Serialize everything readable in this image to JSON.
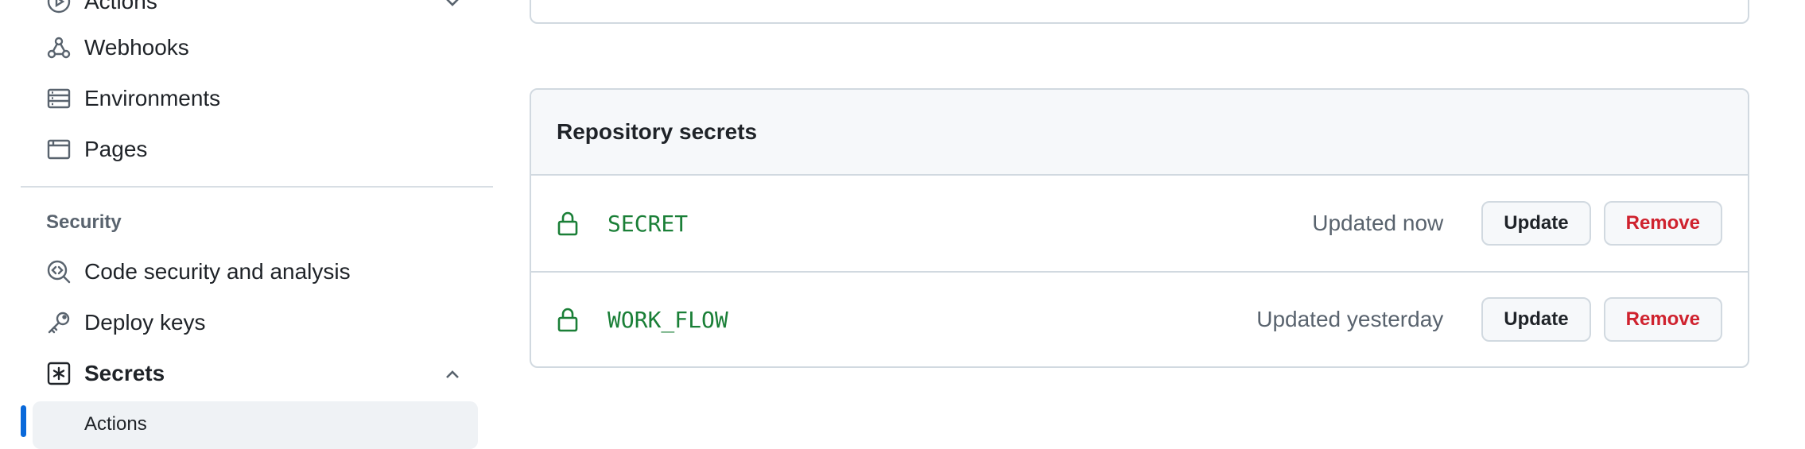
{
  "sidebar": {
    "items": [
      {
        "label": "Actions",
        "icon": "play-circle-icon"
      },
      {
        "label": "Webhooks",
        "icon": "webhook-icon"
      },
      {
        "label": "Environments",
        "icon": "server-icon"
      },
      {
        "label": "Pages",
        "icon": "browser-icon"
      }
    ],
    "security_title": "Security",
    "security_items": [
      {
        "label": "Code security and analysis",
        "icon": "codescan-icon"
      },
      {
        "label": "Deploy keys",
        "icon": "key-icon"
      },
      {
        "label": "Secrets",
        "icon": "asterisk-icon"
      }
    ],
    "secrets_subitem": "Actions"
  },
  "panel": {
    "title": "Repository secrets",
    "rows": [
      {
        "name": "SECRET",
        "updated": "Updated now",
        "update_label": "Update",
        "remove_label": "Remove"
      },
      {
        "name": "WORK_FLOW",
        "updated": "Updated yesterday",
        "update_label": "Update",
        "remove_label": "Remove"
      }
    ]
  },
  "colors": {
    "accent": "#0969da",
    "secret_name": "#1a7f37",
    "danger": "#cf222e",
    "border": "#d1d9e0"
  }
}
